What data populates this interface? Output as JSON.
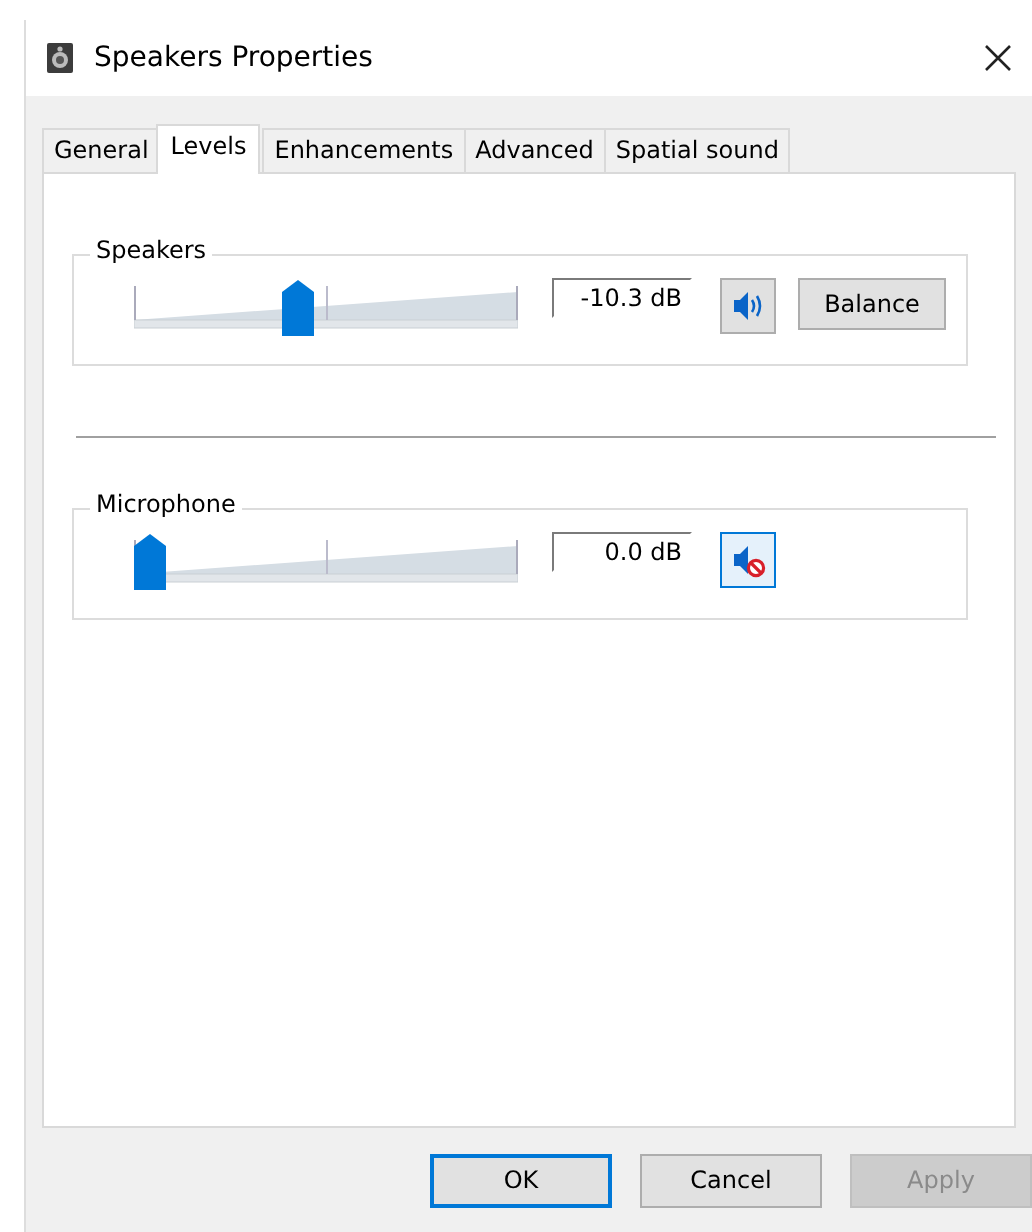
{
  "window": {
    "title": "Speakers Properties"
  },
  "tabs": [
    {
      "label": "General",
      "selected": false
    },
    {
      "label": "Levels",
      "selected": true
    },
    {
      "label": "Enhancements",
      "selected": false
    },
    {
      "label": "Advanced",
      "selected": false
    },
    {
      "label": "Spatial sound",
      "selected": false
    }
  ],
  "channels": [
    {
      "name": "Speakers",
      "level": 0.42,
      "reading": "-10.3 dB",
      "muted": false,
      "balance_button": "Balance"
    },
    {
      "name": "Microphone",
      "level": 0,
      "reading": "0.0 dB",
      "muted": true
    }
  ],
  "buttons": [
    {
      "label": "OK",
      "default": true,
      "disabled": false
    },
    {
      "label": "Cancel",
      "default": false,
      "disabled": false
    },
    {
      "label": "Apply",
      "default": false,
      "disabled": true
    }
  ]
}
